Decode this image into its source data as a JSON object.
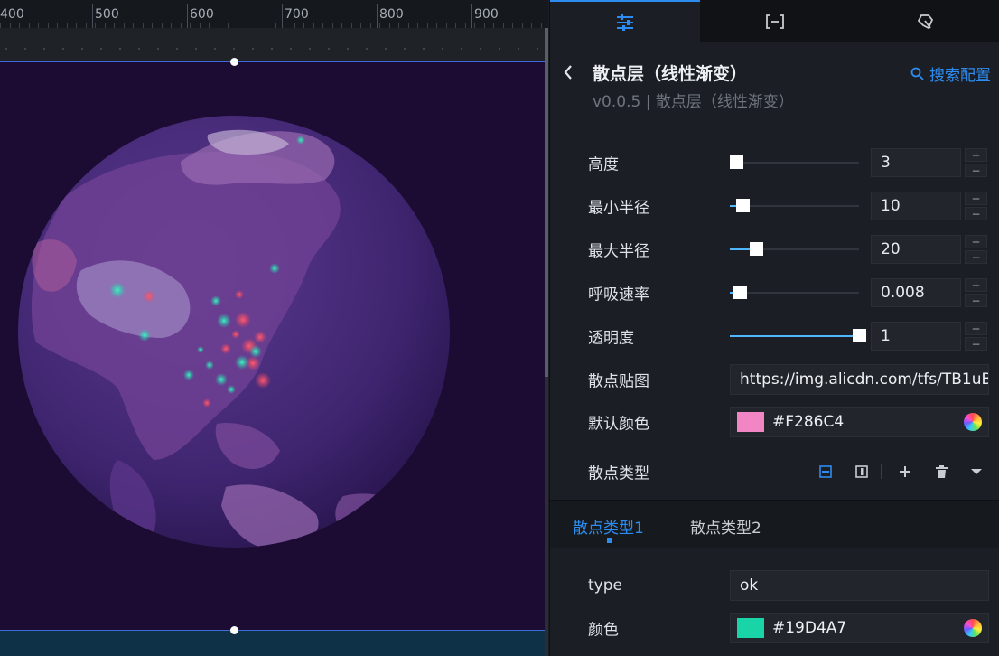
{
  "ruler": {
    "labels": [
      "400",
      "500",
      "600",
      "700",
      "800",
      "900"
    ]
  },
  "scene": {
    "background": "#1c0c34",
    "globe_colors": {
      "ocean": "#42296f",
      "land": "#7a4a9c"
    },
    "scatter_colors": {
      "teal": "#19D4A7",
      "red": "#F2465C"
    }
  },
  "panel": {
    "tabs": [
      {
        "icon": "sliders-icon",
        "active": true
      },
      {
        "icon": "bracket-icon",
        "active": false
      },
      {
        "icon": "cursor-icon",
        "active": false
      }
    ],
    "header": {
      "title": "散点层（线性渐变）",
      "subtitle": "v0.0.5 | 散点层（线性渐变）",
      "search_label": "搜索配置"
    },
    "fields": {
      "height": {
        "label": "高度",
        "value": "3",
        "slider_fraction": 0.0
      },
      "min_radius": {
        "label": "最小半径",
        "value": "10",
        "slider_fraction": 0.1
      },
      "max_radius": {
        "label": "最大半径",
        "value": "20",
        "slider_fraction": 0.2
      },
      "breath_rate": {
        "label": "呼吸速率",
        "value": "0.008",
        "slider_fraction": 0.08
      },
      "opacity": {
        "label": "透明度",
        "value": "1",
        "slider_fraction": 1.0
      },
      "texture": {
        "label": "散点贴图",
        "value": "https://img.alicdn.com/tfs/TB1uBC"
      },
      "default_color": {
        "label": "默认颜色",
        "value": "#F286C4",
        "swatch": "#F286C4"
      },
      "scatter_type": {
        "label": "散点类型"
      }
    },
    "type_toolbar": [
      "list-view-icon",
      "column-view-icon",
      "plus-icon",
      "trash-icon",
      "caret-down-icon"
    ],
    "subtabs": [
      {
        "label": "散点类型1",
        "active": true
      },
      {
        "label": "散点类型2",
        "active": false
      }
    ],
    "type_fields": {
      "type": {
        "label": "type",
        "value": "ok"
      },
      "color": {
        "label": "颜色",
        "value": "#19D4A7",
        "swatch": "#19D4A7"
      }
    },
    "stepper": {
      "plus": "+",
      "minus": "−"
    }
  }
}
